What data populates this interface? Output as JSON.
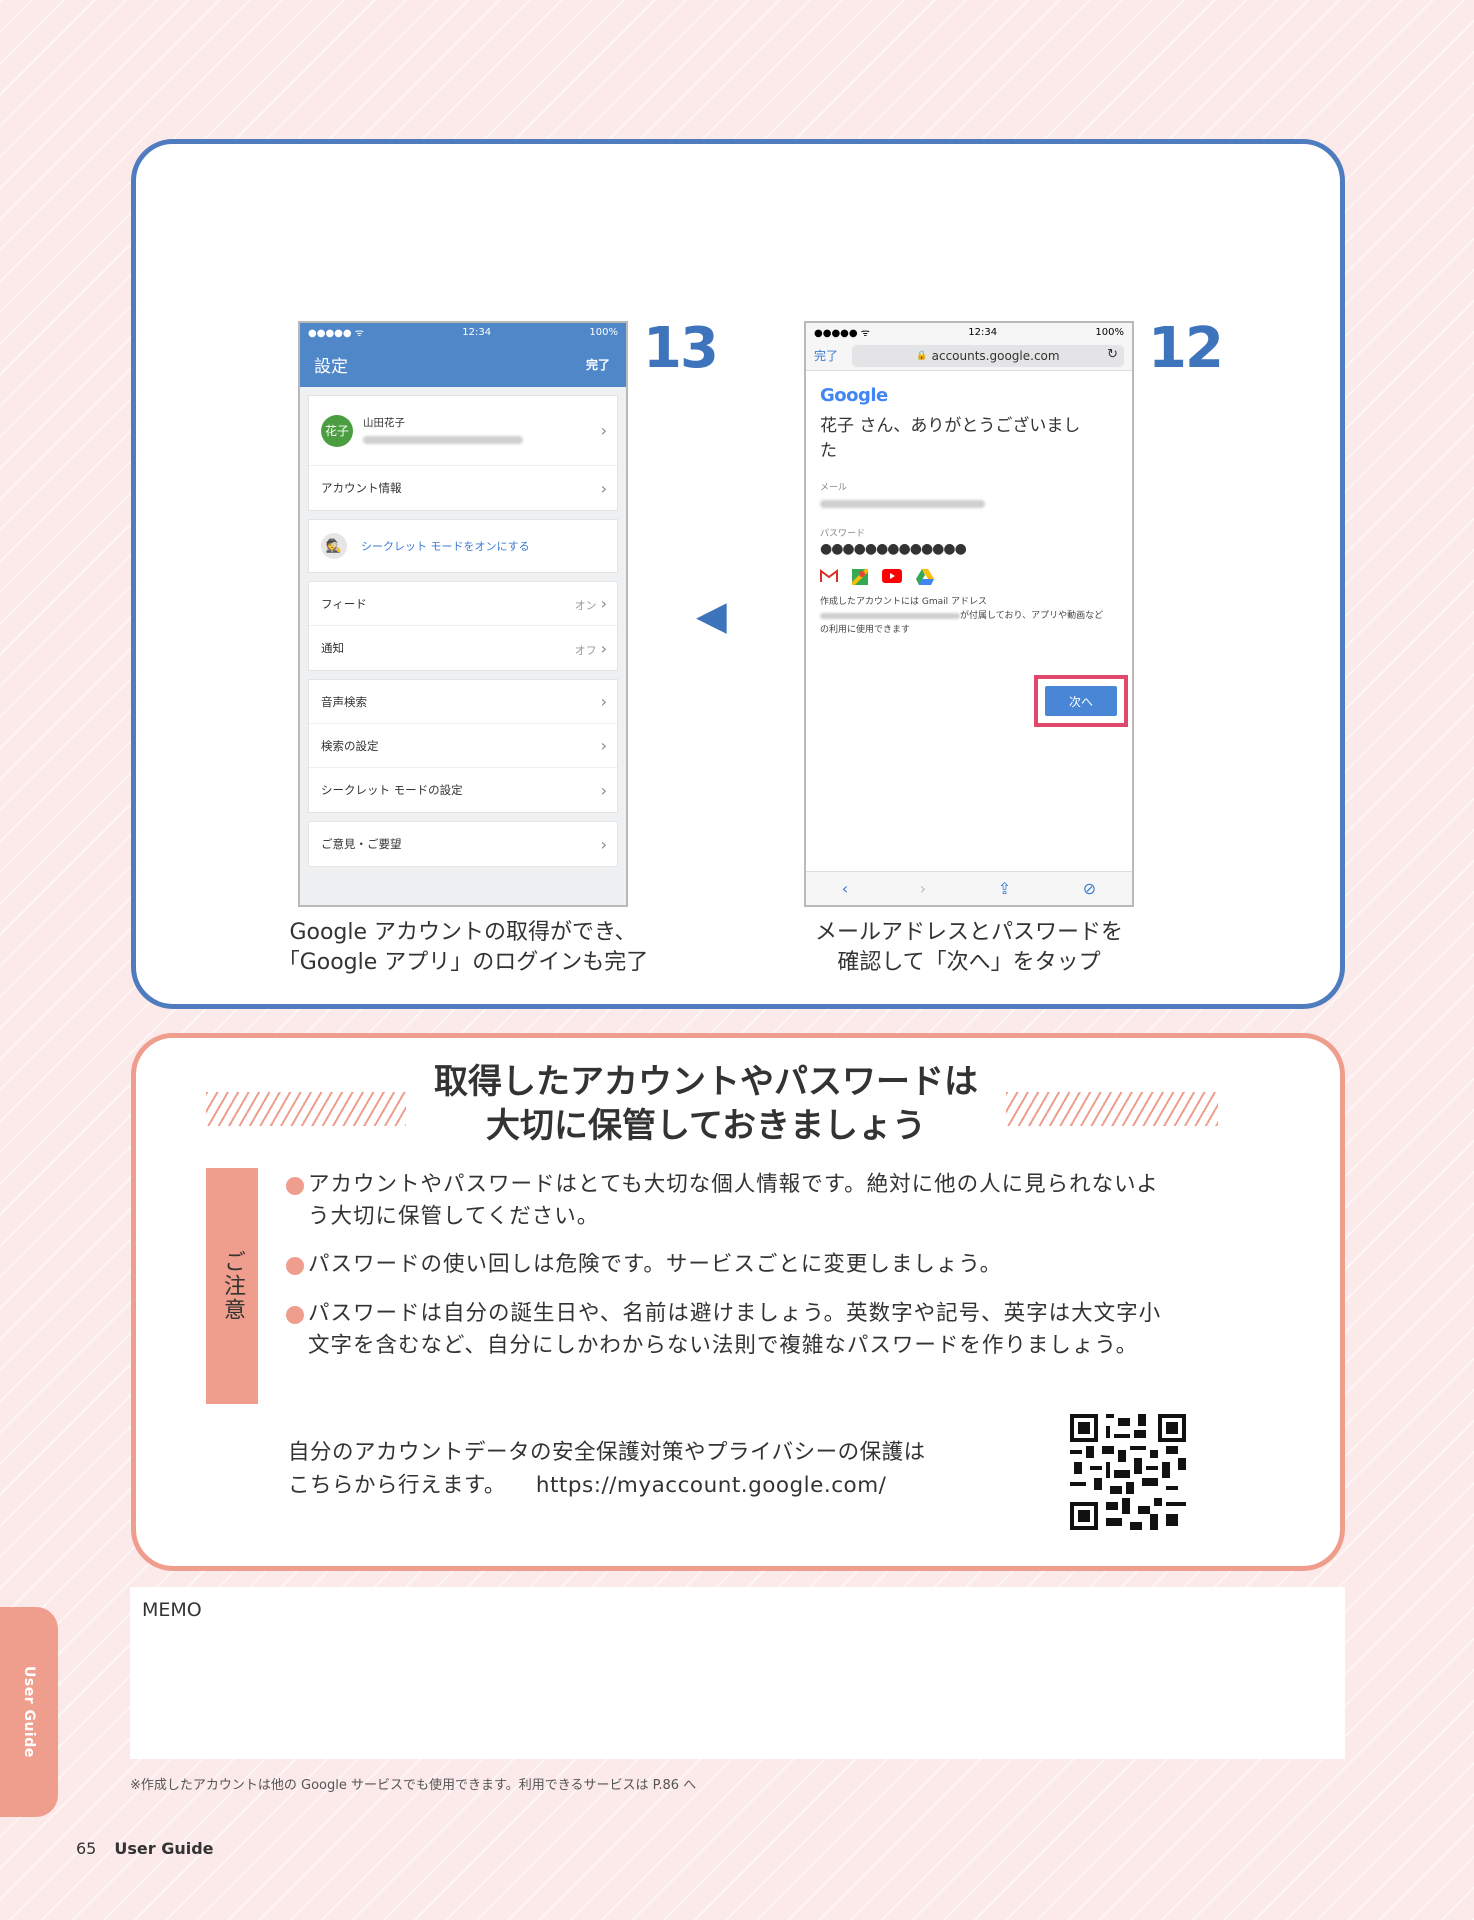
{
  "steps": {
    "step13": {
      "number": "13",
      "caption_line1": "Google アカウントの取得ができ、",
      "caption_line2": "「Google アプリ」のログインも完了",
      "phone": {
        "time": "12:34",
        "battery": "100%",
        "title": "設定",
        "done": "完了",
        "user_name": "山田花子",
        "avatar_text": "花子",
        "account_info": "アカウント情報",
        "incognito_on": "シークレット モードをオンにする",
        "feed": "フィード",
        "feed_value": "オン",
        "notify": "通知",
        "notify_value": "オフ",
        "voice_search": "音声検索",
        "search_settings": "検索の設定",
        "incognito_settings": "シークレット モードの設定",
        "feedback": "ご意見・ご要望"
      }
    },
    "arrow": "◀",
    "step12": {
      "number": "12",
      "caption_line1": "メールアドレスとパスワードを",
      "caption_line2": "確認して「次へ」をタップ",
      "phone": {
        "time": "12:34",
        "battery": "100%",
        "done": "完了",
        "url": "accounts.google.com",
        "logo": "Google",
        "thanks_line1": "花子 さん、ありがとうございまし",
        "thanks_line2": "た",
        "email_label": "メール",
        "password_label": "パスワード",
        "password_dots": "●●●●●●●●●●●●●",
        "desc_line1": "作成したアカウントには Gmail アドレス",
        "desc_line2": "が付属しており、アプリや動画など",
        "desc_line3": "の利用に使用できます",
        "next_button": "次へ"
      }
    }
  },
  "caution": {
    "heading_line1": "取得したアカウントやパスワードは",
    "heading_line2": "大切に保管しておきましょう",
    "side_label": "ご注意",
    "bullets": [
      {
        "line1": "アカウントやパスワードはとても大切な個人情報です。絶対に他の人に見られないよ",
        "line2": "う大切に保管してください。"
      },
      {
        "line1": "パスワードの使い回しは危険です。サービスごとに変更しましょう。",
        "line2": ""
      },
      {
        "line1": "パスワードは自分の誕生日や、名前は避けましょう。英数字や記号、英字は大文字小",
        "line2": "文字を含むなど、自分にしかわからない法則で複雑なパスワードを作りましょう。"
      }
    ],
    "note_line1": "自分のアカウントデータの安全保護対策やプライバシーの保護は",
    "note_line2": "こちらから行えます。",
    "url": "https://myaccount.google.com/"
  },
  "memo_label": "MEMO",
  "footnote": "※作成したアカウントは他の Google サービスでも使用できます。利用できるサービスは P.86 へ",
  "side_tab": "User Guide",
  "page_number": "65",
  "page_title": "User Guide",
  "colors": {
    "blue_frame": "#4e7cbf",
    "pink_frame": "#ef9d8d",
    "step_number": "#3e74bb",
    "background": "#fce9e9"
  }
}
